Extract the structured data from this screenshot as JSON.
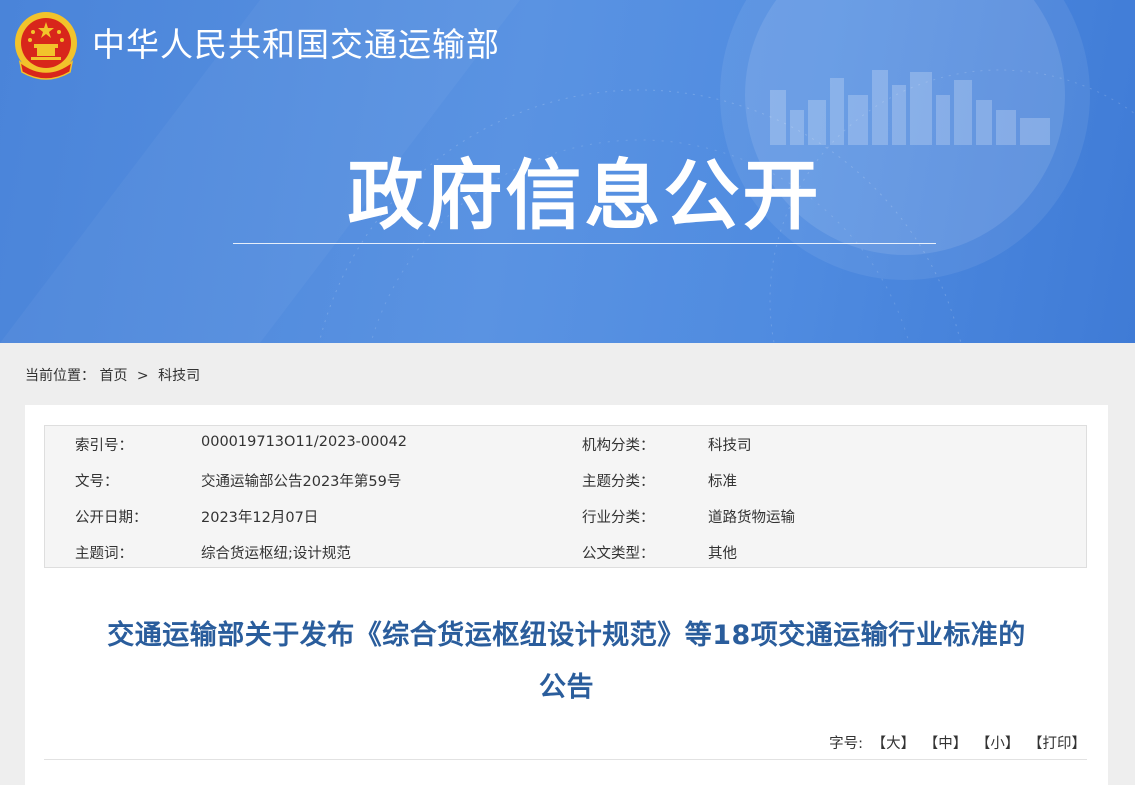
{
  "header": {
    "site_title": "中华人民共和国交通运输部",
    "banner_title": "政府信息公开"
  },
  "breadcrumb": {
    "prefix": "当前位置：",
    "home": "首页",
    "separator": ">",
    "current": "科技司"
  },
  "meta": {
    "rows": [
      {
        "label1": "索引号：",
        "value1": "000019713O11/2023-00042",
        "label2": "机构分类：",
        "value2": "科技司"
      },
      {
        "label1": "文号：",
        "value1": "交通运输部公告2023年第59号",
        "label2": "主题分类：",
        "value2": "标准"
      },
      {
        "label1": "公开日期：",
        "value1": "2023年12月07日",
        "label2": "行业分类：",
        "value2": "道路货物运输"
      },
      {
        "label1": "主题词：",
        "value1": "综合货运枢纽;设计规范",
        "label2": "公文类型：",
        "value2": "其他"
      }
    ]
  },
  "document": {
    "title_line1": "交通运输部关于发布《综合货运枢纽设计规范》等18项交通运输行业标准的",
    "title_line2": "公告"
  },
  "font_tools": {
    "label": "字号:",
    "large": "【大】",
    "medium": "【中】",
    "small": "【小】",
    "print": "【打印】"
  },
  "colors": {
    "banner_blue": "#4f8be0",
    "title_blue": "#2a5d9c",
    "emblem_red": "#d8261b",
    "emblem_gold": "#f2c32b"
  }
}
